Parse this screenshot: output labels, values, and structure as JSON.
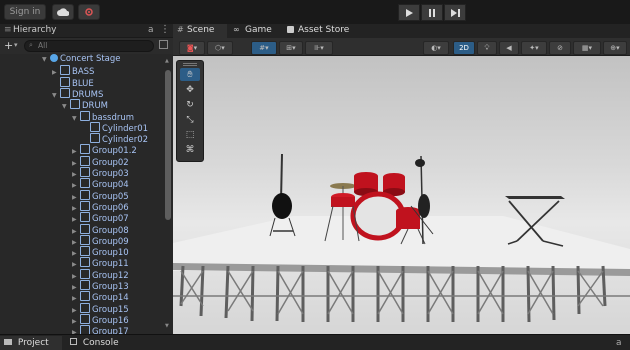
{
  "toolbar": {
    "signin_label": "Sign in",
    "cloud_icon": "cloud-icon",
    "collab_icon": "collab-icon",
    "play_icon": "play-icon",
    "pause_icon": "pause-icon",
    "step_icon": "step-icon"
  },
  "hierarchy": {
    "tab_label": "Hierarchy",
    "search_placeholder": "All",
    "items": [
      {
        "label": "Concert Stage",
        "depth": 0,
        "open": true,
        "root": true
      },
      {
        "label": "BASS",
        "depth": 1,
        "open": false
      },
      {
        "label": "BLUE",
        "depth": 1,
        "open": null
      },
      {
        "label": "DRUMS",
        "depth": 1,
        "open": true
      },
      {
        "label": "DRUM",
        "depth": 2,
        "open": true
      },
      {
        "label": "bassdrum",
        "depth": 3,
        "open": true
      },
      {
        "label": "Cylinder01",
        "depth": 4,
        "open": null
      },
      {
        "label": "Cylinder02",
        "depth": 4,
        "open": null
      },
      {
        "label": "Group01.2",
        "depth": 3,
        "open": false
      },
      {
        "label": "Group02",
        "depth": 3,
        "open": false
      },
      {
        "label": "Group03",
        "depth": 3,
        "open": false
      },
      {
        "label": "Group04",
        "depth": 3,
        "open": false
      },
      {
        "label": "Group05",
        "depth": 3,
        "open": false
      },
      {
        "label": "Group06",
        "depth": 3,
        "open": false
      },
      {
        "label": "Group07",
        "depth": 3,
        "open": false
      },
      {
        "label": "Group08",
        "depth": 3,
        "open": false
      },
      {
        "label": "Group09",
        "depth": 3,
        "open": false
      },
      {
        "label": "Group10",
        "depth": 3,
        "open": false
      },
      {
        "label": "Group11",
        "depth": 3,
        "open": false
      },
      {
        "label": "Group12",
        "depth": 3,
        "open": false
      },
      {
        "label": "Group13",
        "depth": 3,
        "open": false
      },
      {
        "label": "Group14",
        "depth": 3,
        "open": false
      },
      {
        "label": "Group15",
        "depth": 3,
        "open": false
      },
      {
        "label": "Group16",
        "depth": 3,
        "open": false
      },
      {
        "label": "Group17",
        "depth": 3,
        "open": false
      }
    ]
  },
  "scene": {
    "tabs": [
      {
        "label": "Scene",
        "icon": "grid-icon"
      },
      {
        "label": "Game",
        "icon": "gamepad-icon"
      },
      {
        "label": "Asset Store",
        "icon": "bag-icon"
      }
    ],
    "toggle_2d": "2D"
  },
  "bottom": {
    "tabs": [
      {
        "label": "Project",
        "icon": "folder-icon"
      },
      {
        "label": "Console",
        "icon": "console-icon"
      }
    ]
  },
  "colors": {
    "accent": "#2c5d87",
    "tree_text": "#a8c4f4",
    "drum_red": "#c0121e"
  }
}
